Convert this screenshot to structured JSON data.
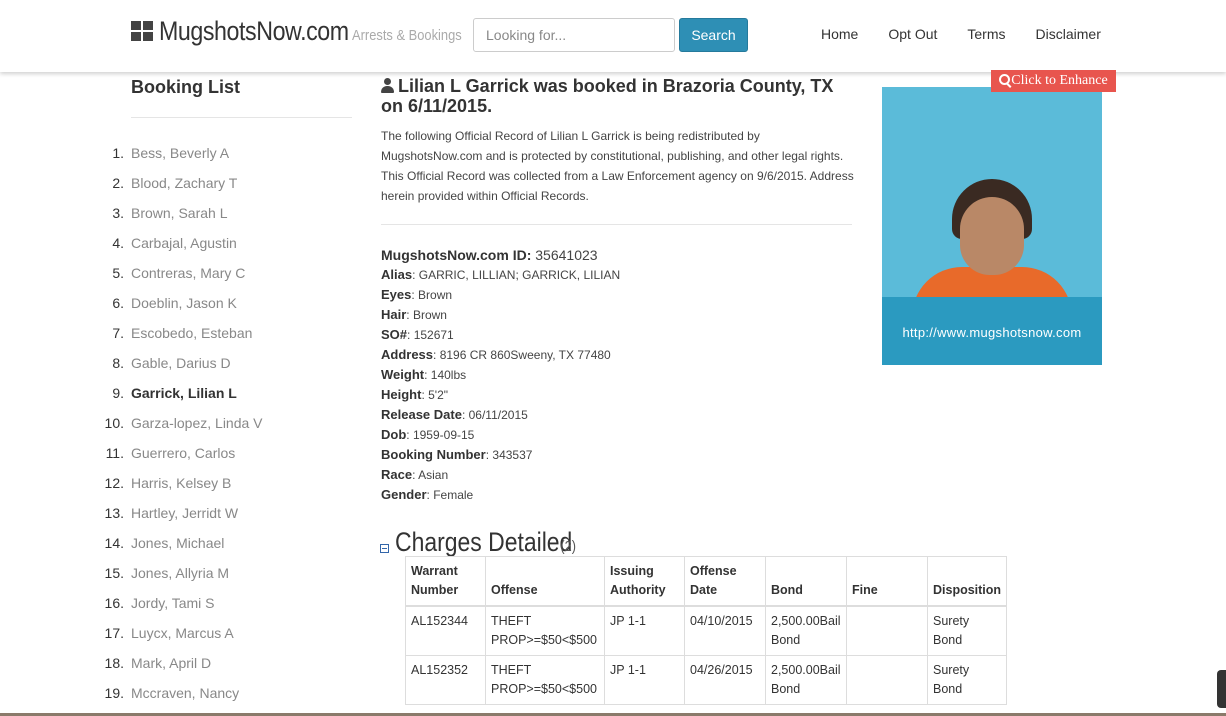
{
  "header": {
    "brand_name": "MugshotsNow.com",
    "brand_tagline": "Arrests & Bookings",
    "search_placeholder": "Looking for...",
    "search_button": "Search",
    "nav": [
      "Home",
      "Opt Out",
      "Terms",
      "Disclaimer"
    ]
  },
  "sidebar": {
    "title": "Booking List",
    "items": [
      {
        "num": "1.",
        "name": "Bess, Beverly A"
      },
      {
        "num": "2.",
        "name": "Blood, Zachary T"
      },
      {
        "num": "3.",
        "name": "Brown, Sarah L"
      },
      {
        "num": "4.",
        "name": "Carbajal, Agustin"
      },
      {
        "num": "5.",
        "name": "Contreras, Mary C"
      },
      {
        "num": "6.",
        "name": "Doeblin, Jason K"
      },
      {
        "num": "7.",
        "name": "Escobedo, Esteban"
      },
      {
        "num": "8.",
        "name": "Gable, Darius D"
      },
      {
        "num": "9.",
        "name": "Garrick, Lilian L"
      },
      {
        "num": "10.",
        "name": "Garza-lopez, Linda V"
      },
      {
        "num": "11.",
        "name": "Guerrero, Carlos"
      },
      {
        "num": "12.",
        "name": "Harris, Kelsey B"
      },
      {
        "num": "13.",
        "name": "Hartley, Jerridt W"
      },
      {
        "num": "14.",
        "name": "Jones, Michael"
      },
      {
        "num": "15.",
        "name": "Jones, Allyria M"
      },
      {
        "num": "16.",
        "name": "Jordy, Tami S"
      },
      {
        "num": "17.",
        "name": "Luycx, Marcus A"
      },
      {
        "num": "18.",
        "name": "Mark, April D"
      },
      {
        "num": "19.",
        "name": "Mccraven, Nancy"
      }
    ],
    "active_index": 8
  },
  "main": {
    "headline": "Lilian L Garrick was booked in Brazoria County, TX on 6/11/2015.",
    "intro": "The following Official Record of Lilian L Garrick is being redistributed by MugshotsNow.com and is protected by constitutional, publishing, and other legal rights. This Official Record was collected from a Law Enforcement agency on 9/6/2015. Address herein provided within Official Records.",
    "record_id_label": "MugshotsNow.com ID:",
    "record_id": "35641023",
    "fields": [
      {
        "label": "Alias",
        "value": "GARRIC, LILLIAN; GARRICK, LILIAN"
      },
      {
        "label": "Eyes",
        "value": "Brown"
      },
      {
        "label": "Hair",
        "value": "Brown"
      },
      {
        "label": "SO#",
        "value": "152671"
      },
      {
        "label": "Address",
        "value": "8196 CR 860Sweeny, TX 77480"
      },
      {
        "label": "Weight",
        "value": "140lbs"
      },
      {
        "label": "Height",
        "value": "5'2\""
      },
      {
        "label": "Release Date",
        "value": "06/11/2015"
      },
      {
        "label": "Dob",
        "value": "1959-09-15"
      },
      {
        "label": "Booking Number",
        "value": "343537"
      },
      {
        "label": "Race",
        "value": "Asian"
      },
      {
        "label": "Gender",
        "value": "Female"
      }
    ]
  },
  "image": {
    "enhance_label": "Click to Enhance",
    "url_overlay": "http://www.mugshotsnow.com"
  },
  "charges": {
    "title": "Charges Detailed",
    "count": "(2)",
    "columns": [
      "Warrant Number",
      "Offense",
      "Issuing Authority",
      "Offense Date",
      "Bond",
      "Fine",
      "Disposition"
    ],
    "rows": [
      [
        "AL152344",
        "THEFT PROP>=$50<$500",
        "JP 1-1",
        "04/10/2015",
        "2,500.00Bail Bond",
        "",
        "Surety Bond"
      ],
      [
        "AL152352",
        "THEFT PROP>=$50<$500",
        "JP 1-1",
        "04/26/2015",
        "2,500.00Bail Bond",
        "",
        "Surety Bond"
      ]
    ]
  }
}
